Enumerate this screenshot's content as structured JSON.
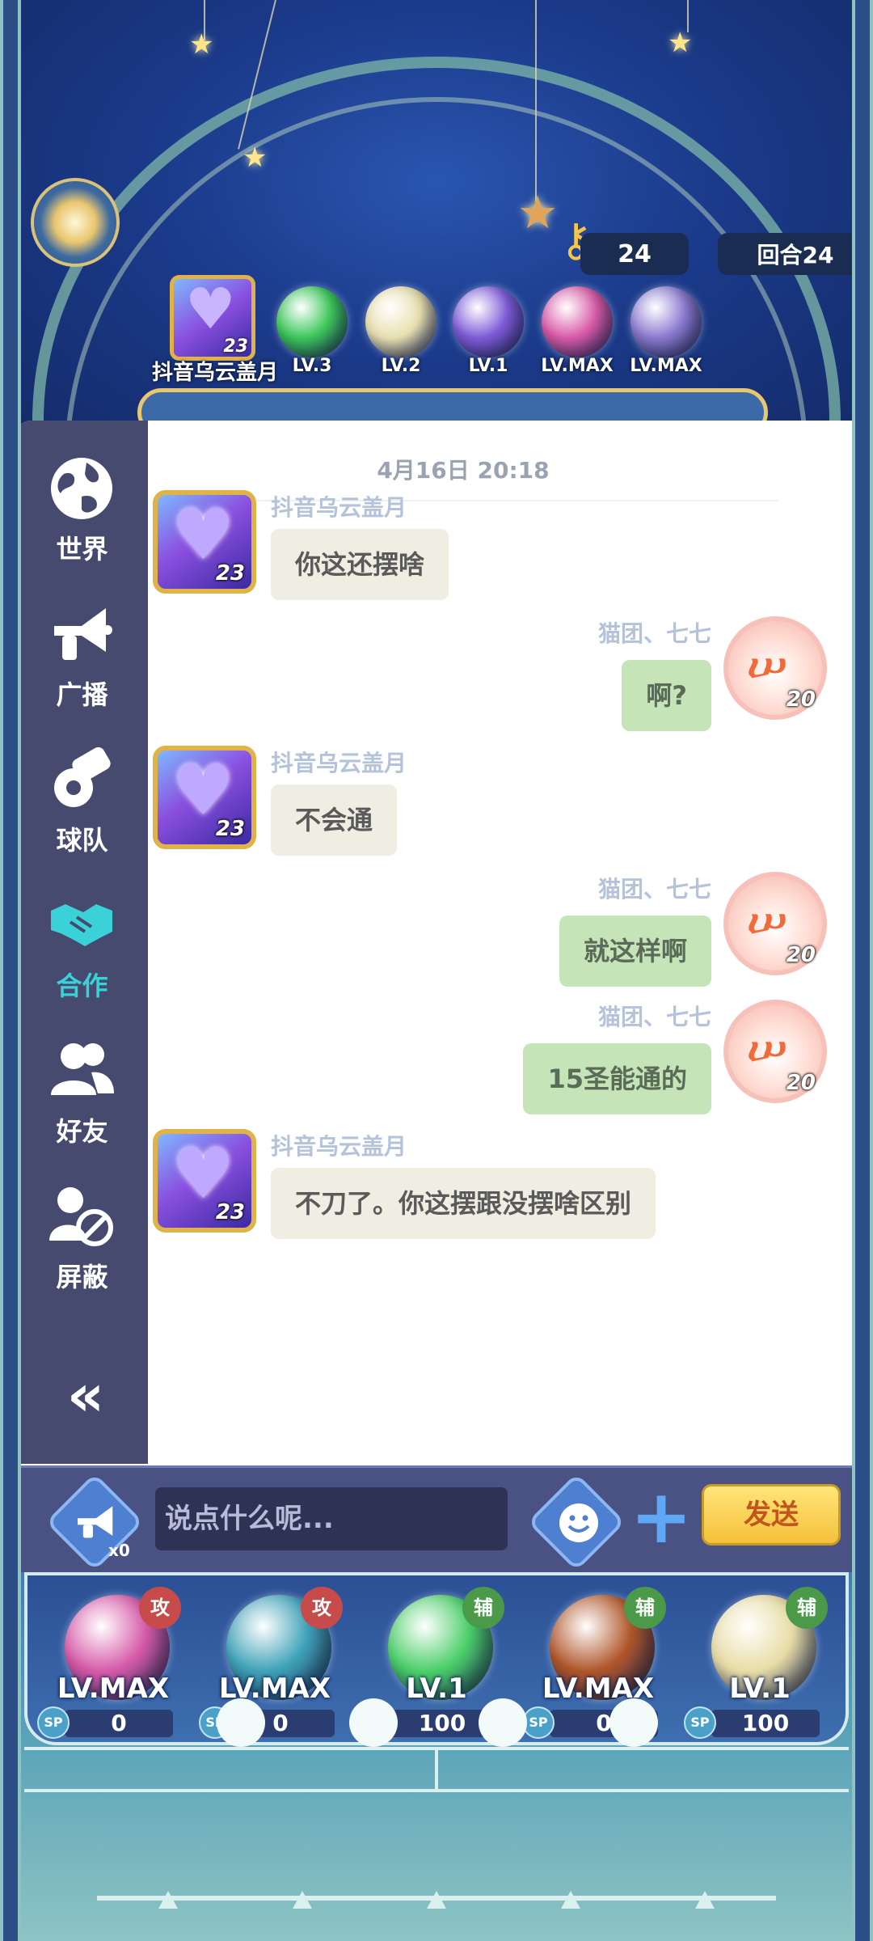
{
  "hud": {
    "key_count": "24",
    "round_label": "回合24"
  },
  "team": {
    "leader_name": "抖音乌云盖月",
    "leader_level_badge": "23",
    "slots": [
      {
        "level": "LV.3",
        "color": "#3cc75a"
      },
      {
        "level": "LV.2",
        "color": "#e8e0b0"
      },
      {
        "level": "LV.1",
        "color": "#7f5bd8"
      },
      {
        "level": "LV.MAX",
        "color": "#d95aa8"
      },
      {
        "level": "LV.MAX",
        "color": "#8b7ad0"
      }
    ]
  },
  "side_nav": {
    "items": [
      {
        "label": "世界",
        "icon": "globe-icon"
      },
      {
        "label": "广播",
        "icon": "megaphone-icon"
      },
      {
        "label": "球队",
        "icon": "whistle-icon"
      },
      {
        "label": "合作",
        "icon": "handshake-icon",
        "active": true
      },
      {
        "label": "好友",
        "icon": "friends-icon"
      },
      {
        "label": "屏蔽",
        "icon": "block-user-icon"
      }
    ],
    "collapse_icon": "double-chevron-left-icon"
  },
  "chat": {
    "timestamp": "4月16日 20:18",
    "messages": [
      {
        "side": "left",
        "sender": "抖音乌云盖月",
        "level": "23",
        "text": "你这还摆啥"
      },
      {
        "side": "right",
        "sender": "猫团、七七",
        "level": "20",
        "text": "啊?"
      },
      {
        "side": "left",
        "sender": "抖音乌云盖月",
        "level": "23",
        "text": "不会通"
      },
      {
        "side": "right",
        "sender": "猫团、七七",
        "level": "20",
        "text": "就这样啊"
      },
      {
        "side": "right",
        "sender": "猫团、七七",
        "level": "20",
        "text": "15圣能通的"
      },
      {
        "side": "left",
        "sender": "抖音乌云盖月",
        "level": "23",
        "text": "不刀了。你这摆跟没摆啥区别"
      }
    ]
  },
  "input": {
    "broadcast_count": "x0",
    "placeholder": "说点什么呢...",
    "send_label": "发送",
    "plus_label": "+"
  },
  "skills": [
    {
      "tag": "攻",
      "tag_color": "#c84b4b",
      "level": "LV.MAX",
      "sp": "0",
      "color": "#d65aa8"
    },
    {
      "tag": "攻",
      "tag_color": "#c84b4b",
      "level": "LV.MAX",
      "sp": "0",
      "color": "#3fa2b8"
    },
    {
      "tag": "辅",
      "tag_color": "#4a9a4a",
      "level": "LV.1",
      "sp": "100",
      "color": "#4ccf6a"
    },
    {
      "tag": "辅",
      "tag_color": "#4a9a4a",
      "level": "LV.MAX",
      "sp": "0",
      "color": "#b0562a"
    },
    {
      "tag": "辅",
      "tag_color": "#4a9a4a",
      "level": "LV.1",
      "sp": "100",
      "color": "#e8dca6"
    }
  ],
  "sp_label": "SP"
}
